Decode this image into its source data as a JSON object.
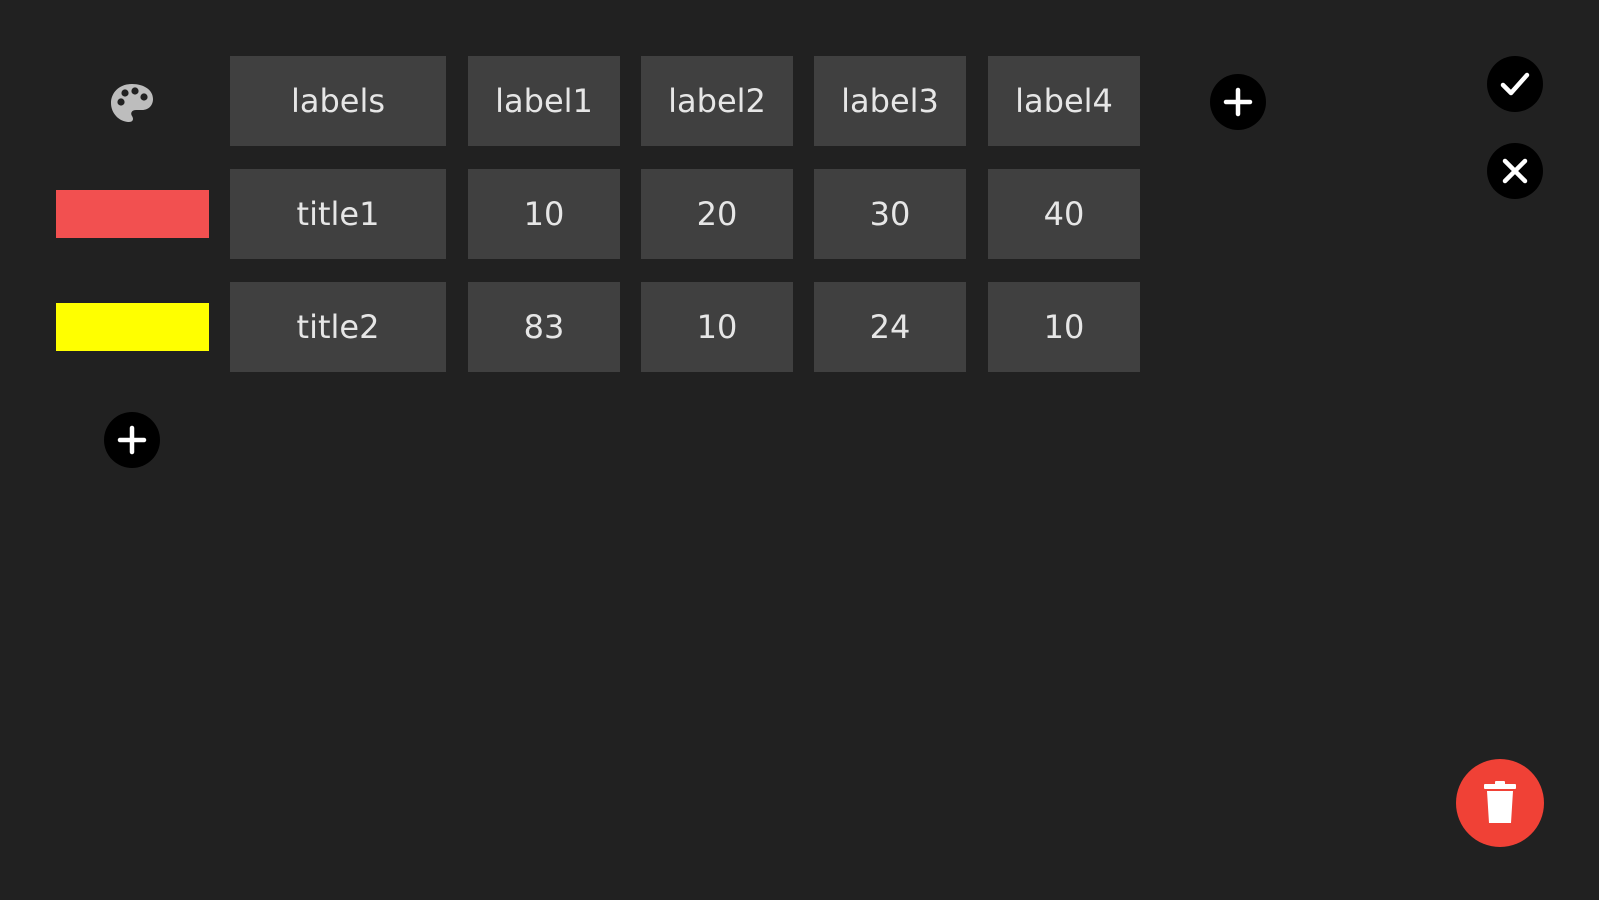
{
  "toolbar": {
    "palette_icon": "palette-icon",
    "add_column_icon": "plus-icon",
    "add_row_icon": "plus-icon",
    "confirm_icon": "check-icon",
    "cancel_icon": "close-icon",
    "delete_icon": "trash-icon"
  },
  "table": {
    "header": [
      "labels",
      "label1",
      "label2",
      "label3",
      "label4"
    ],
    "rows": [
      {
        "title": "title1",
        "color": "#f25050",
        "values": [
          "10",
          "20",
          "30",
          "40"
        ]
      },
      {
        "title": "title2",
        "color": "#ffff00",
        "values": [
          "83",
          "10",
          "24",
          "10"
        ]
      }
    ]
  },
  "colors": {
    "background": "#212121",
    "cell": "#404040",
    "delete_button": "#f04136"
  }
}
